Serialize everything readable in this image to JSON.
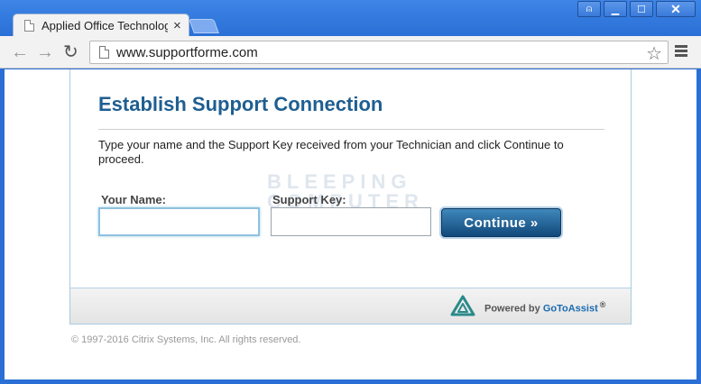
{
  "browser": {
    "tab_title": "Applied Office Technology",
    "tab_close": "×",
    "url": "www.supportforme.com",
    "window_controls": [
      "user-icon",
      "minimize-icon",
      "maximize-icon",
      "close-icon"
    ],
    "glyphs": {
      "user": "⍝",
      "minimize": "▁",
      "maximize": "☐",
      "close": "✕",
      "back": "←",
      "forward": "→",
      "reload": "↻",
      "star": "☆"
    }
  },
  "page": {
    "title": "Establish Support Connection",
    "instructions": "Type your name and the Support Key received from your Technician and click Continue to proceed.",
    "watermark_line1": "BLEEPING",
    "watermark_line2": "COMPUTER",
    "form": {
      "name_label": "Your Name:",
      "name_value": "",
      "key_label": "Support Key:",
      "key_value": "",
      "continue_label": "Continue »"
    },
    "footer": {
      "powered_by": "Powered by",
      "brand": "GoToAssist",
      "registered": "®"
    },
    "copyright": "© 1997-2016 Citrix Systems, Inc. All rights reserved."
  },
  "colors": {
    "title": "#1f5e91",
    "button": "#11497a",
    "brand": "#1c6bb0",
    "logo": "#2a8a8a",
    "window": "#2a6fd6"
  }
}
